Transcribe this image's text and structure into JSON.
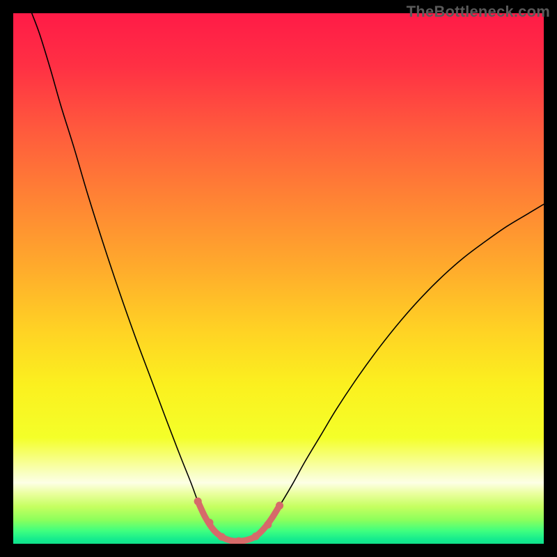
{
  "watermark": "TheBottleneck.com",
  "chart_data": {
    "type": "line",
    "title": "",
    "xlabel": "",
    "ylabel": "",
    "xlim": [
      0,
      100
    ],
    "ylim": [
      0,
      100
    ],
    "grid": false,
    "legend": false,
    "background_gradient": {
      "stops": [
        {
          "offset": 0.0,
          "color": "#ff1b47"
        },
        {
          "offset": 0.1,
          "color": "#ff3044"
        },
        {
          "offset": 0.22,
          "color": "#ff5a3d"
        },
        {
          "offset": 0.35,
          "color": "#ff8334"
        },
        {
          "offset": 0.48,
          "color": "#ffab2c"
        },
        {
          "offset": 0.6,
          "color": "#ffd324"
        },
        {
          "offset": 0.7,
          "color": "#fbf01f"
        },
        {
          "offset": 0.8,
          "color": "#f4ff29"
        },
        {
          "offset": 0.87,
          "color": "#f9ffc8"
        },
        {
          "offset": 0.885,
          "color": "#fdffe6"
        },
        {
          "offset": 0.905,
          "color": "#ebffa0"
        },
        {
          "offset": 0.93,
          "color": "#c5ff60"
        },
        {
          "offset": 0.955,
          "color": "#8cff5c"
        },
        {
          "offset": 0.976,
          "color": "#3eff80"
        },
        {
          "offset": 0.992,
          "color": "#14eb8e"
        },
        {
          "offset": 1.0,
          "color": "#10e08b"
        }
      ]
    },
    "series": [
      {
        "name": "bottleneck-curve",
        "stroke": "#000000",
        "stroke_width": 1.6,
        "points": [
          {
            "x": 3.5,
            "y": 100.0
          },
          {
            "x": 5.0,
            "y": 96.0
          },
          {
            "x": 7.0,
            "y": 89.5
          },
          {
            "x": 9.0,
            "y": 82.5
          },
          {
            "x": 11.5,
            "y": 74.5
          },
          {
            "x": 14.0,
            "y": 66.0
          },
          {
            "x": 17.0,
            "y": 56.5
          },
          {
            "x": 20.0,
            "y": 47.5
          },
          {
            "x": 23.0,
            "y": 39.0
          },
          {
            "x": 26.0,
            "y": 31.0
          },
          {
            "x": 29.0,
            "y": 23.0
          },
          {
            "x": 31.5,
            "y": 16.5
          },
          {
            "x": 33.5,
            "y": 11.5
          },
          {
            "x": 35.0,
            "y": 7.5
          },
          {
            "x": 36.5,
            "y": 4.5
          },
          {
            "x": 38.0,
            "y": 2.3
          },
          {
            "x": 39.5,
            "y": 1.0
          },
          {
            "x": 41.0,
            "y": 0.5
          },
          {
            "x": 42.5,
            "y": 0.4
          },
          {
            "x": 44.0,
            "y": 0.5
          },
          {
            "x": 45.5,
            "y": 1.0
          },
          {
            "x": 47.0,
            "y": 2.3
          },
          {
            "x": 48.5,
            "y": 4.3
          },
          {
            "x": 50.0,
            "y": 6.8
          },
          {
            "x": 52.5,
            "y": 11.0
          },
          {
            "x": 55.0,
            "y": 15.5
          },
          {
            "x": 58.0,
            "y": 20.5
          },
          {
            "x": 61.0,
            "y": 25.5
          },
          {
            "x": 65.0,
            "y": 31.5
          },
          {
            "x": 69.0,
            "y": 37.0
          },
          {
            "x": 73.0,
            "y": 42.0
          },
          {
            "x": 77.0,
            "y": 46.5
          },
          {
            "x": 81.0,
            "y": 50.5
          },
          {
            "x": 85.0,
            "y": 54.0
          },
          {
            "x": 89.0,
            "y": 57.0
          },
          {
            "x": 93.0,
            "y": 59.8
          },
          {
            "x": 97.0,
            "y": 62.2
          },
          {
            "x": 100.0,
            "y": 64.0
          }
        ]
      },
      {
        "name": "optimal-zone-overlay",
        "stroke": "#d66a6a",
        "stroke_width": 9,
        "points": [
          {
            "x": 34.8,
            "y": 8.0
          },
          {
            "x": 36.2,
            "y": 5.0
          },
          {
            "x": 37.7,
            "y": 2.7
          },
          {
            "x": 39.3,
            "y": 1.3
          },
          {
            "x": 41.0,
            "y": 0.6
          },
          {
            "x": 42.5,
            "y": 0.5
          },
          {
            "x": 44.0,
            "y": 0.7
          },
          {
            "x": 45.7,
            "y": 1.4
          },
          {
            "x": 47.3,
            "y": 2.9
          },
          {
            "x": 48.8,
            "y": 4.9
          },
          {
            "x": 50.2,
            "y": 7.2
          }
        ],
        "markers": [
          {
            "x": 34.8,
            "y": 8.0
          },
          {
            "x": 37.0,
            "y": 4.0
          },
          {
            "x": 39.3,
            "y": 1.3
          },
          {
            "x": 42.5,
            "y": 0.5
          },
          {
            "x": 45.7,
            "y": 1.4
          },
          {
            "x": 48.0,
            "y": 3.6
          },
          {
            "x": 50.2,
            "y": 7.2
          }
        ]
      }
    ]
  }
}
